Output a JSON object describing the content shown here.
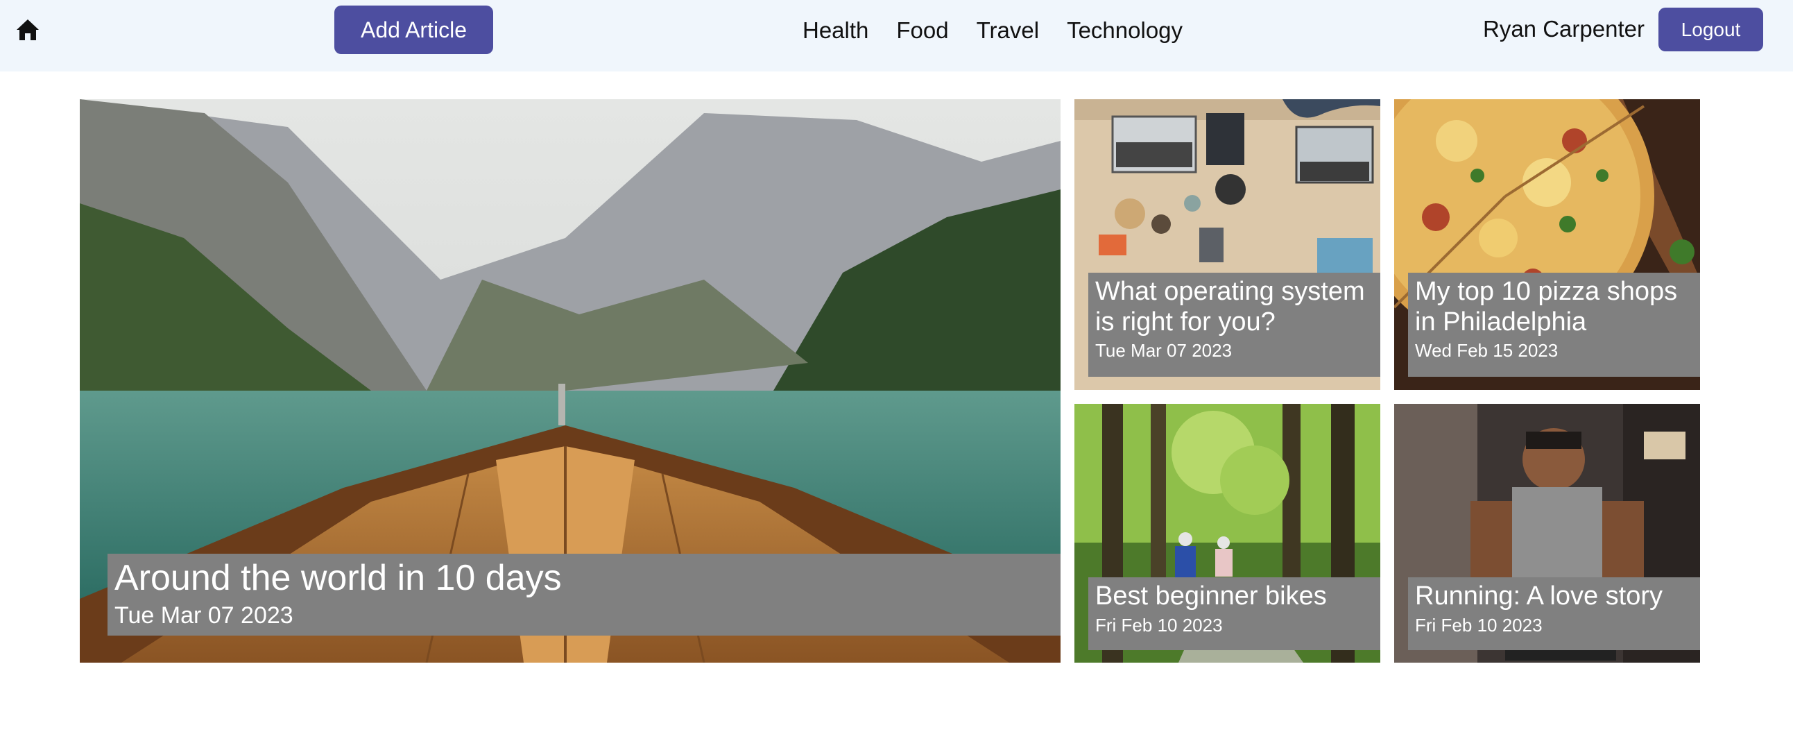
{
  "navbar": {
    "home_icon": "home-icon",
    "add_article_label": "Add Article",
    "categories": [
      "Health",
      "Food",
      "Travel",
      "Technology"
    ],
    "user_name": "Ryan Carpenter",
    "logout_label": "Logout",
    "accent_color": "#4d4ea0",
    "background_color": "#f0f6fc"
  },
  "articles": [
    {
      "title": "Around the world in 10 days",
      "date": "Tue Mar 07 2023"
    },
    {
      "title": "What operating system is right for you?",
      "date": "Tue Mar 07 2023"
    },
    {
      "title": "My top 10 pizza shops in Philadelphia",
      "date": "Wed Feb 15 2023"
    },
    {
      "title": "Best beginner bikes",
      "date": "Fri Feb 10 2023"
    },
    {
      "title": "Running: A love story",
      "date": "Fri Feb 10 2023"
    }
  ]
}
